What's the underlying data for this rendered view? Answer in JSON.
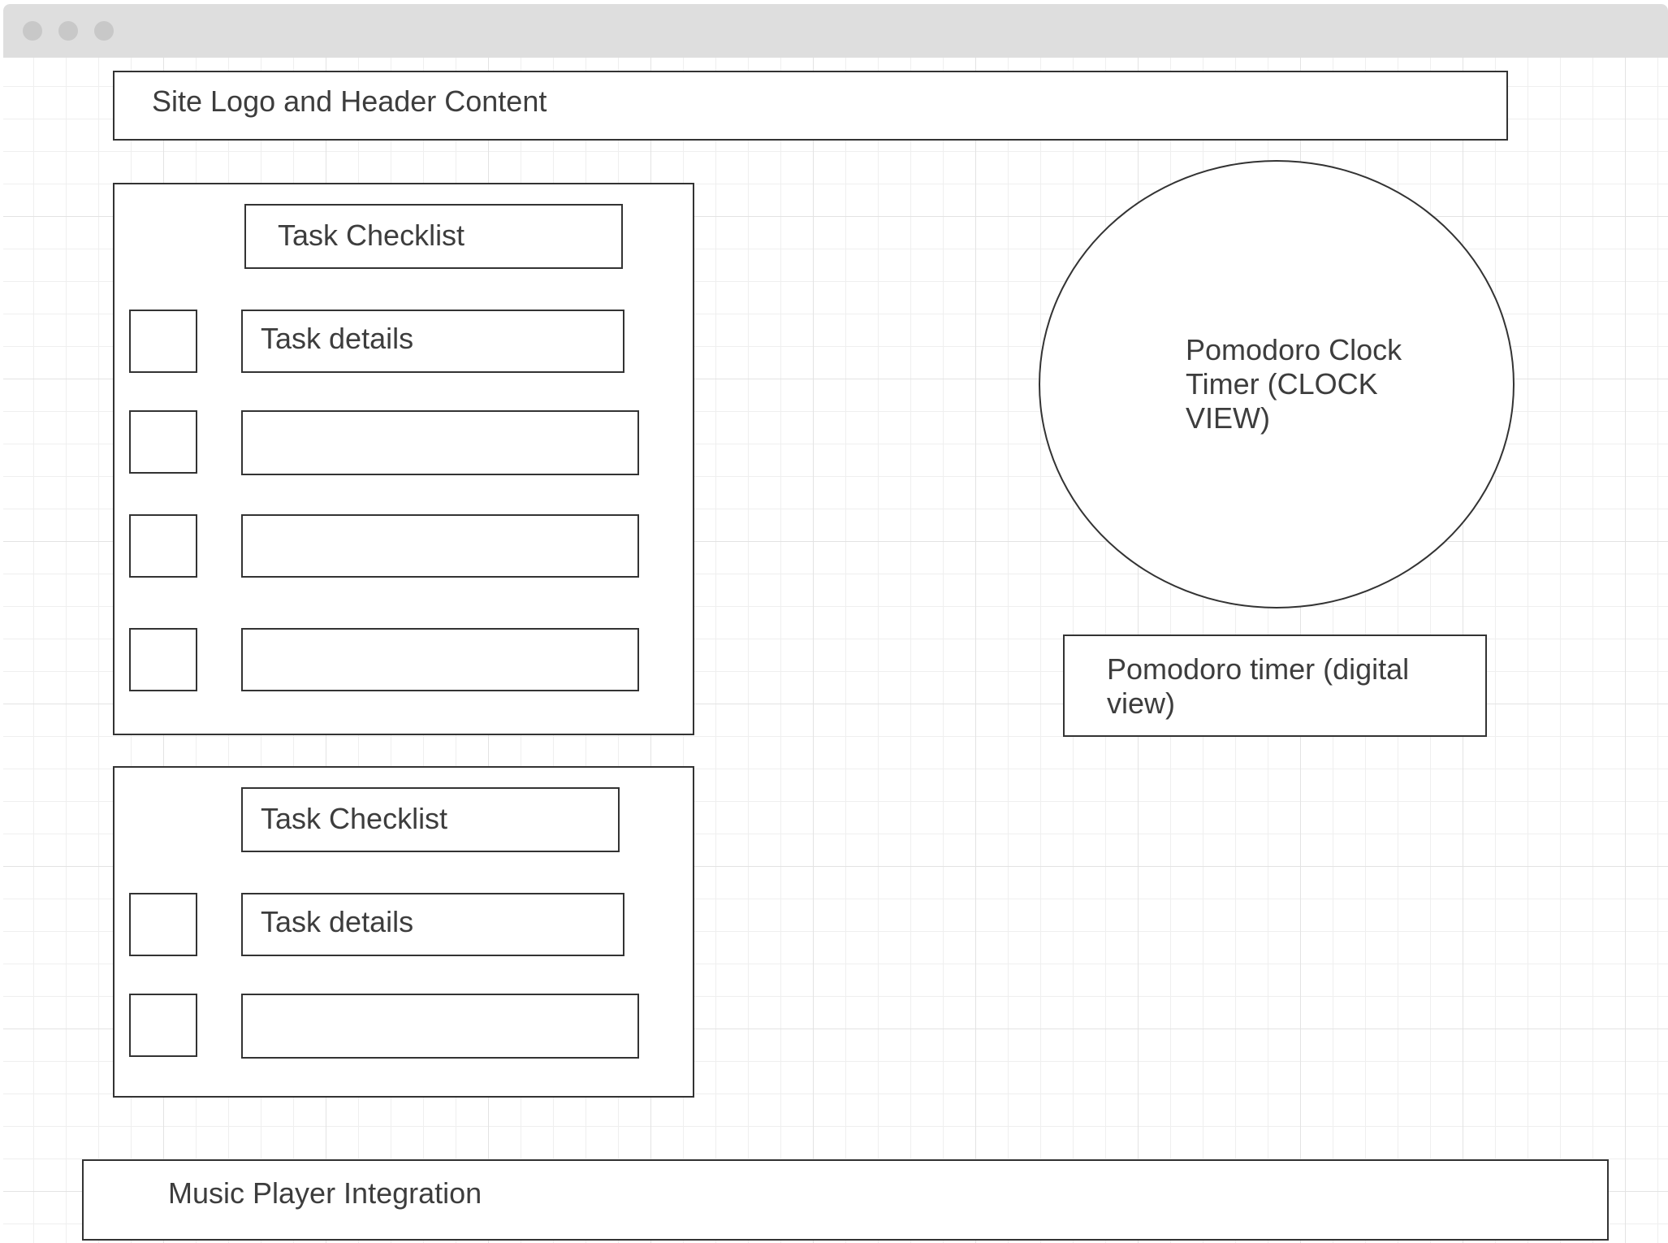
{
  "header": {
    "label": "Site Logo and Header Content"
  },
  "task_panels": [
    {
      "title": "Task Checklist",
      "items": [
        {
          "label": "Task details"
        },
        {
          "label": ""
        },
        {
          "label": ""
        },
        {
          "label": ""
        }
      ]
    },
    {
      "title": "Task Checklist",
      "items": [
        {
          "label": "Task details"
        },
        {
          "label": ""
        }
      ]
    }
  ],
  "pomodoro": {
    "clock_line1": "Pomodoro Clock",
    "clock_line2": "Timer (CLOCK",
    "clock_line3": "VIEW)",
    "digital_line1": "Pomodoro timer (digital",
    "digital_line2": "view)"
  },
  "music": {
    "label": "Music Player Integration"
  }
}
